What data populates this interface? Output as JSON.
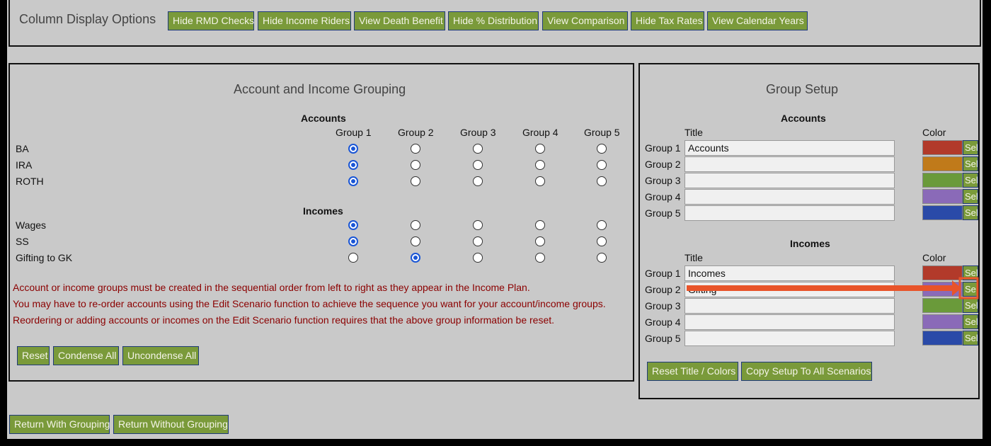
{
  "toolbar": {
    "label": "Column Display Options",
    "buttons": [
      "Hide RMD Checks",
      "Hide Income Riders",
      "View Death Benefit",
      "Hide % Distribution",
      "View Comparison",
      "Hide Tax Rates",
      "View Calendar Years"
    ]
  },
  "grouping": {
    "title": "Account and Income Grouping",
    "accounts_header": "Accounts",
    "incomes_header": "Incomes",
    "group_columns": [
      "Group 1",
      "Group 2",
      "Group 3",
      "Group 4",
      "Group 5"
    ],
    "accounts": [
      {
        "name": "BA",
        "selected": 1
      },
      {
        "name": "IRA",
        "selected": 1
      },
      {
        "name": "ROTH",
        "selected": 1
      }
    ],
    "incomes": [
      {
        "name": "Wages",
        "selected": 1
      },
      {
        "name": "SS",
        "selected": 1
      },
      {
        "name": "Gifting to GK",
        "selected": 2
      }
    ],
    "notes": [
      "Account or income groups must be created in the sequential order from left to right as they appear in the Income Plan.",
      "You may have to re-order accounts using the Edit Scenario function to achieve the sequence you want for your account/income groups.",
      "Reordering or adding accounts or incomes on the Edit Scenario function requires that the above group information be reset."
    ],
    "buttons": [
      "Reset",
      "Condense All",
      "Uncondense All"
    ]
  },
  "setup": {
    "title": "Group Setup",
    "accounts_header": "Accounts",
    "incomes_header": "Incomes",
    "title_col": "Title",
    "color_col": "Color",
    "select_label": "Sel",
    "account_groups": [
      {
        "label": "Group 1",
        "title": "Accounts",
        "color": "#b23a2a"
      },
      {
        "label": "Group 2",
        "title": "",
        "color": "#c07a1a"
      },
      {
        "label": "Group 3",
        "title": "",
        "color": "#6a9a3a"
      },
      {
        "label": "Group 4",
        "title": "",
        "color": "#8a6ab8"
      },
      {
        "label": "Group 5",
        "title": "",
        "color": "#2a4aa8"
      }
    ],
    "income_groups": [
      {
        "label": "Group 1",
        "title": "Incomes",
        "color": "#b23a2a"
      },
      {
        "label": "Group 2",
        "title": "Gifting",
        "color": "#8a6ab8"
      },
      {
        "label": "Group 3",
        "title": "",
        "color": "#6a9a3a"
      },
      {
        "label": "Group 4",
        "title": "",
        "color": "#8a6ab8"
      },
      {
        "label": "Group 5",
        "title": "",
        "color": "#2a4aa8"
      }
    ],
    "buttons": [
      "Reset Title / Colors",
      "Copy Setup To All Scenarios"
    ]
  },
  "footer": {
    "buttons": [
      "Return With Grouping",
      "Return Without Grouping"
    ]
  },
  "annotation": {
    "arrow_color": "#e8542a"
  }
}
